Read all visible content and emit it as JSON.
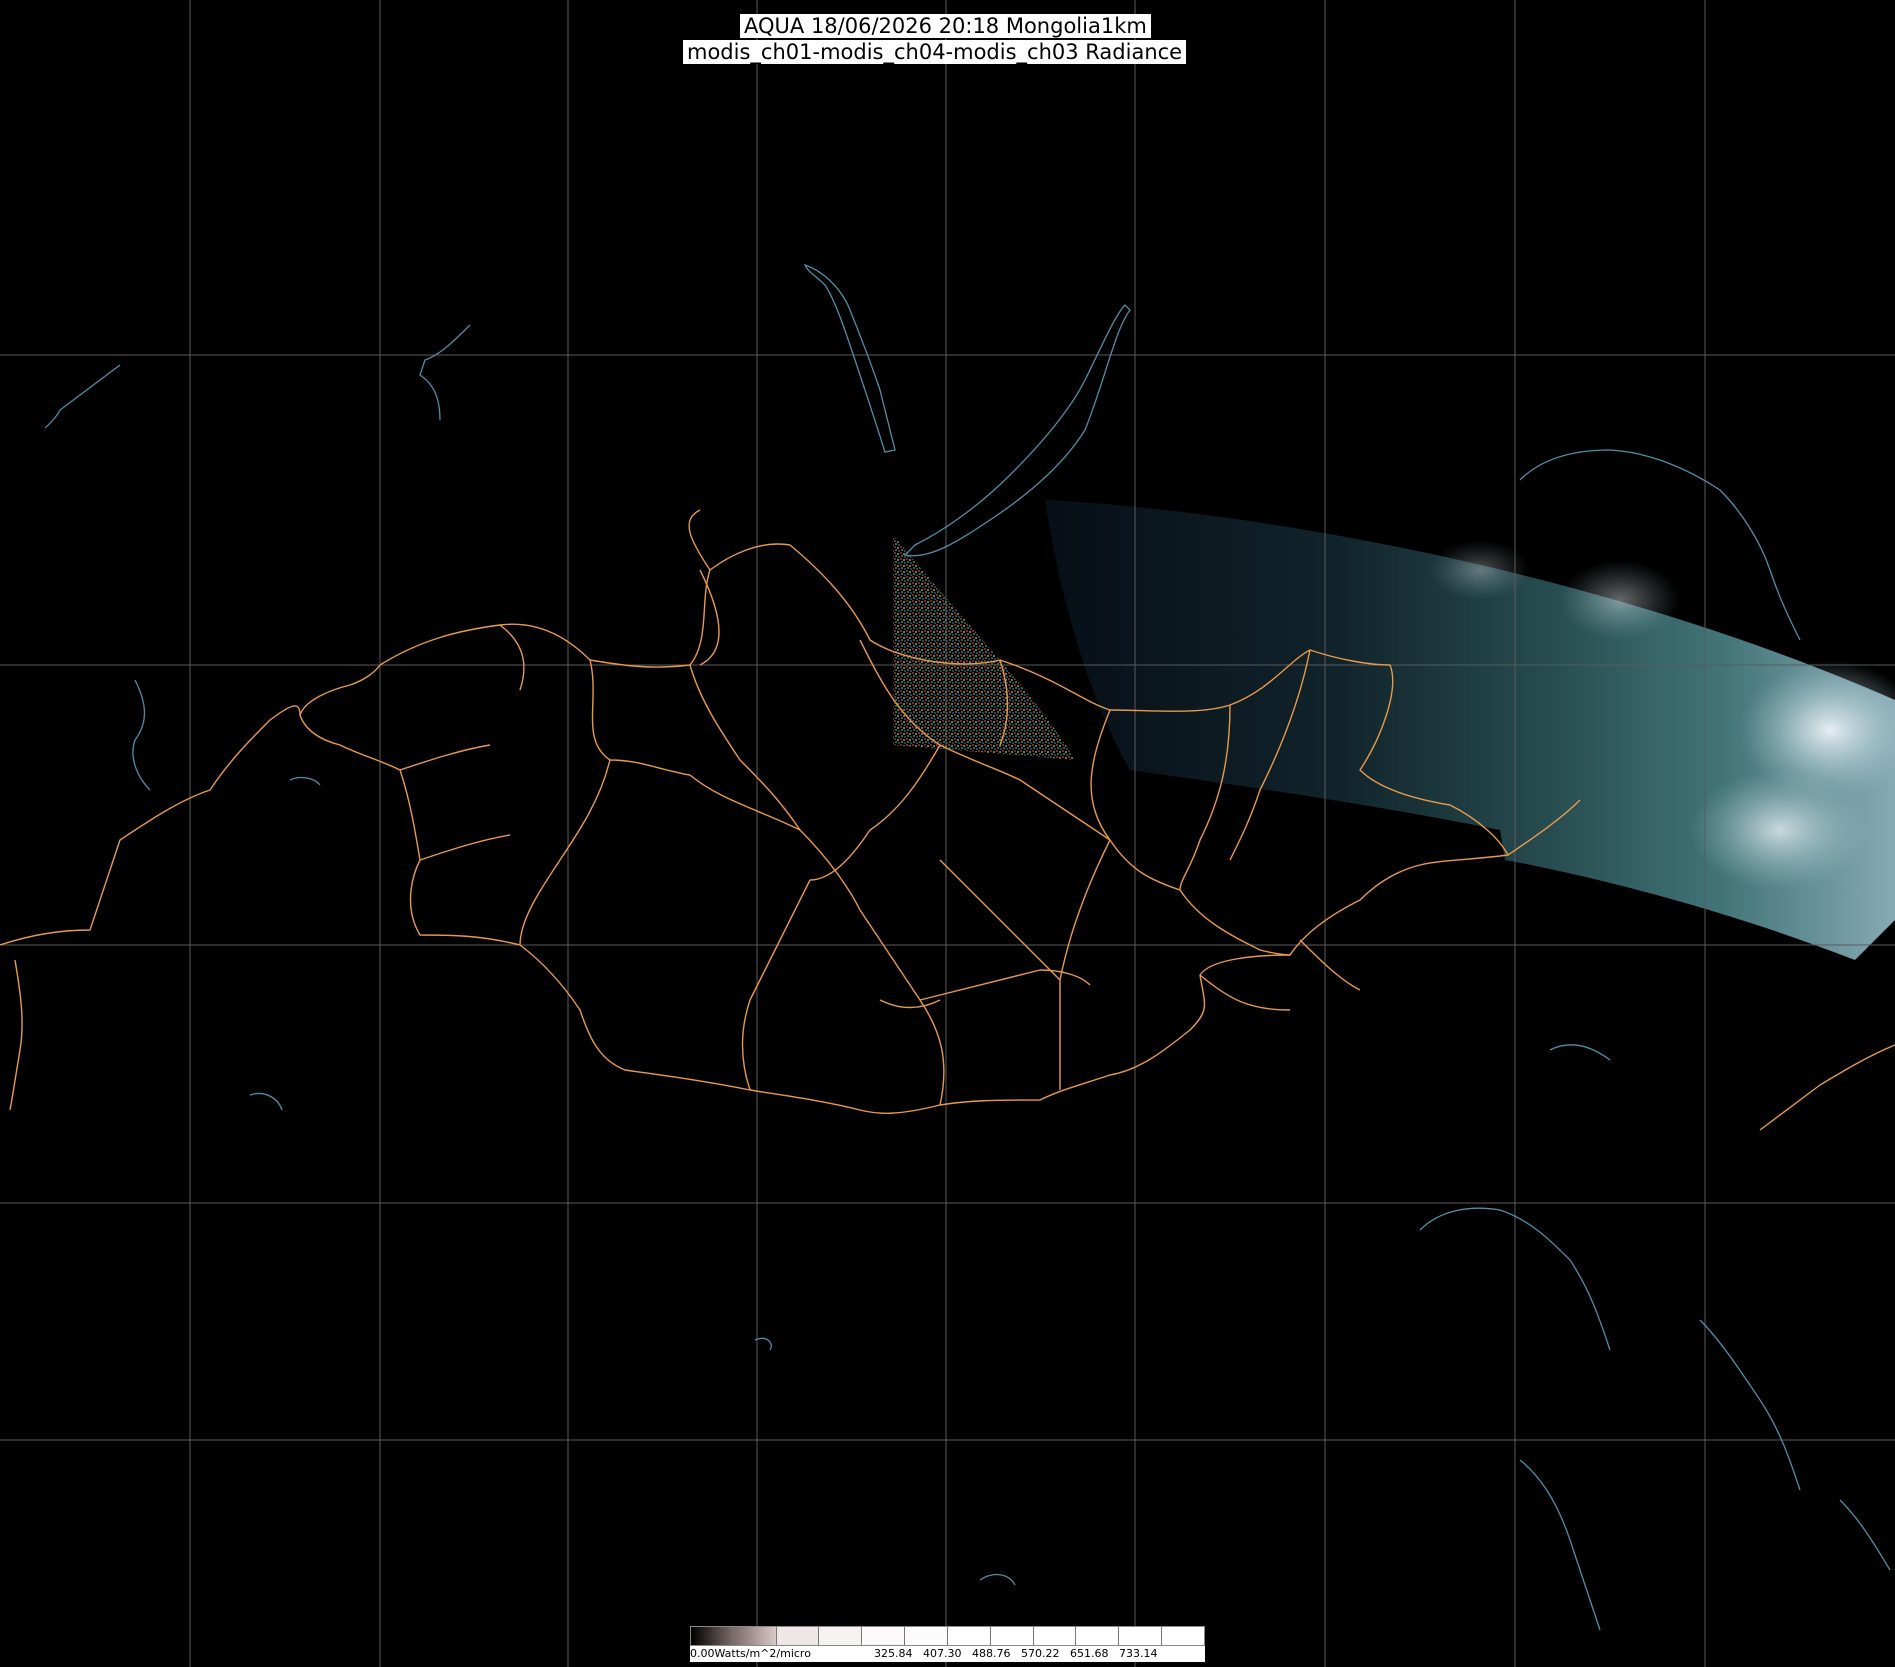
{
  "header": {
    "line1": "AQUA 18/06/2026 20:18 Mongolia1km",
    "line2": "modis_ch01-modis_ch04-modis_ch03 Radiance"
  },
  "legend": {
    "unit_label": "0.00Watts/m^2/micro",
    "ticks": [
      "325.84",
      "407.30",
      "488.76",
      "570.22",
      "651.68",
      "733.14"
    ]
  },
  "colors": {
    "background": "#000000",
    "grid": "#5a5a5a",
    "boundaries": "#e79a4c",
    "coastlines": "#4f8fa6"
  }
}
